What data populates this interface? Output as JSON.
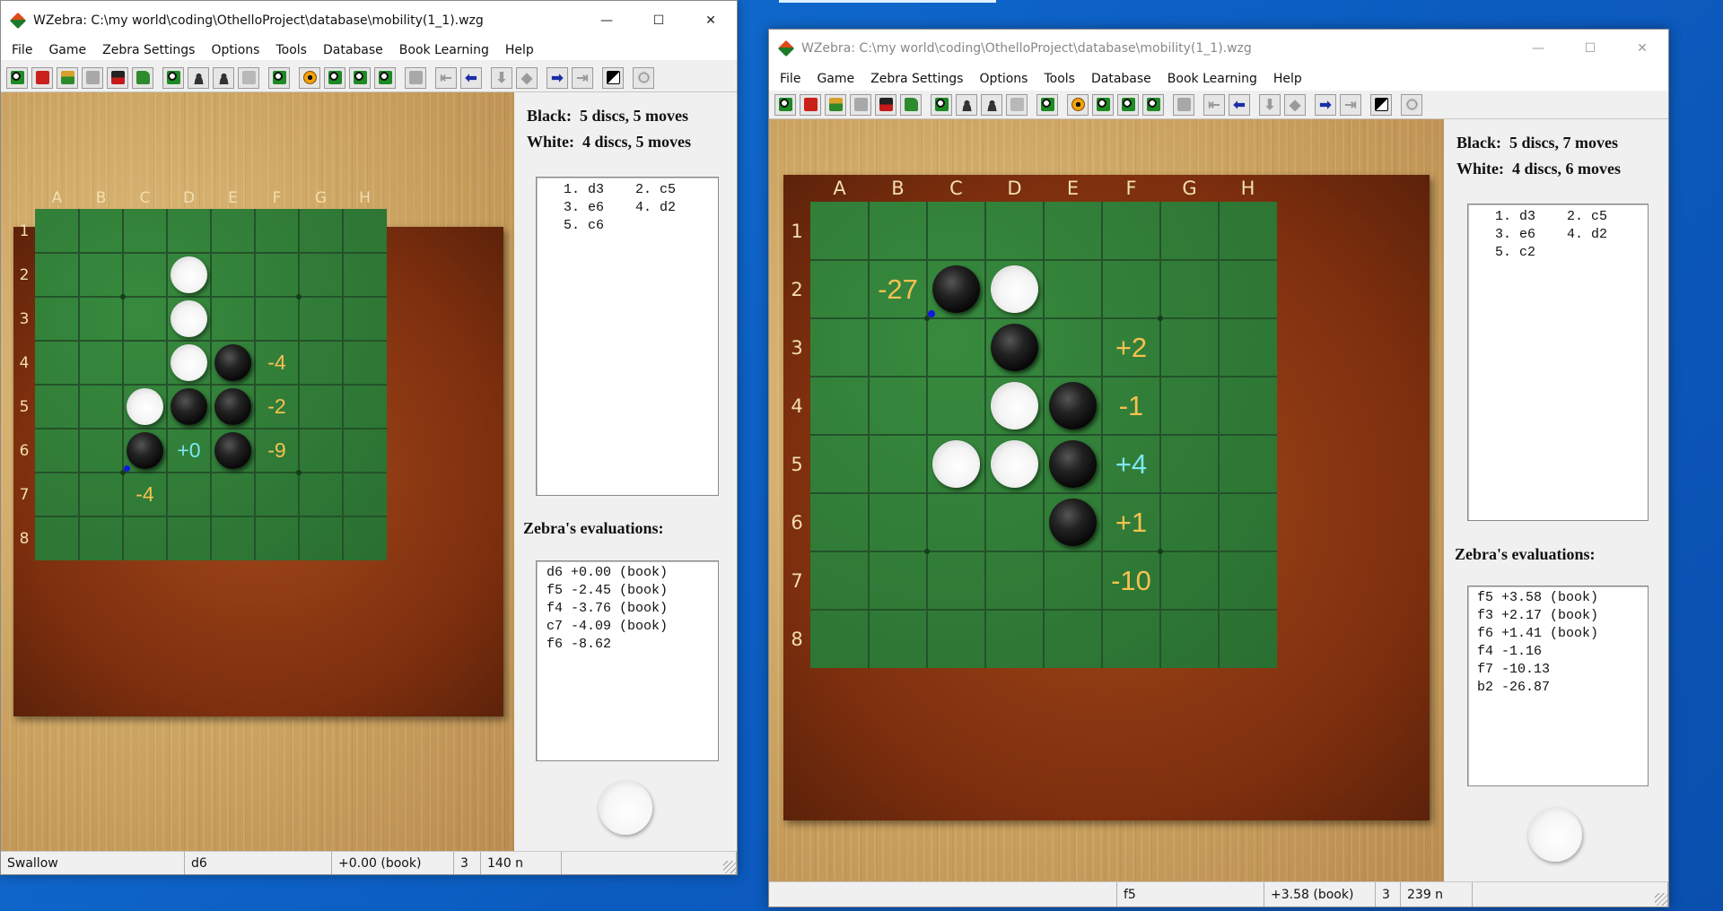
{
  "title_suffix": "",
  "windows": [
    {
      "id": "left",
      "title": "WZebra: C:\\my world\\coding\\OthelloProject\\database\\mobility(1_1).wzg",
      "active": true,
      "menu": [
        "File",
        "Game",
        "Zebra Settings",
        "Options",
        "Tools",
        "Database",
        "Book Learning",
        "Help"
      ],
      "columns": [
        "A",
        "B",
        "C",
        "D",
        "E",
        "F",
        "G",
        "H"
      ],
      "rows": [
        "1",
        "2",
        "3",
        "4",
        "5",
        "6",
        "7",
        "8"
      ],
      "discs": [
        {
          "sq": "d2",
          "color": "white"
        },
        {
          "sq": "d3",
          "color": "white"
        },
        {
          "sq": "d4",
          "color": "white"
        },
        {
          "sq": "e4",
          "color": "black"
        },
        {
          "sq": "c5",
          "color": "white"
        },
        {
          "sq": "d5",
          "color": "black"
        },
        {
          "sq": "e5",
          "color": "black"
        },
        {
          "sq": "c6",
          "color": "black"
        },
        {
          "sq": "e6",
          "color": "black"
        }
      ],
      "evals": [
        {
          "sq": "f4",
          "text": "-4",
          "best": false
        },
        {
          "sq": "f5",
          "text": "-2",
          "best": false
        },
        {
          "sq": "d6",
          "text": "+0",
          "best": true
        },
        {
          "sq": "f6",
          "text": "-9",
          "best": false
        },
        {
          "sq": "c7",
          "text": "-4",
          "best": false
        }
      ],
      "last_move": "c6",
      "black_count": "Black:  5 discs, 5 moves",
      "white_count": "White:  4 discs, 5 moves",
      "moves": [
        [
          "1. d3",
          "2. c5"
        ],
        [
          "3. e6",
          "4. d2"
        ],
        [
          "5. c6",
          ""
        ]
      ],
      "eval_title": "Zebra's evaluations:",
      "evaluations": [
        "d6 +0.00 (book)",
        "f5 -2.45 (book)",
        "f4 -3.76 (book)",
        "c7 -4.09 (book)",
        "f6 -8.62"
      ],
      "to_move": "white",
      "status": [
        "Swallow",
        "d6",
        "+0.00 (book)",
        "3",
        "140 n",
        ""
      ]
    },
    {
      "id": "right",
      "title": "WZebra: C:\\my world\\coding\\OthelloProject\\database\\mobility(1_1).wzg",
      "active": false,
      "menu": [
        "File",
        "Game",
        "Zebra Settings",
        "Options",
        "Tools",
        "Database",
        "Book Learning",
        "Help"
      ],
      "columns": [
        "A",
        "B",
        "C",
        "D",
        "E",
        "F",
        "G",
        "H"
      ],
      "rows": [
        "1",
        "2",
        "3",
        "4",
        "5",
        "6",
        "7",
        "8"
      ],
      "discs": [
        {
          "sq": "c2",
          "color": "black"
        },
        {
          "sq": "d2",
          "color": "white"
        },
        {
          "sq": "d3",
          "color": "black"
        },
        {
          "sq": "d4",
          "color": "white"
        },
        {
          "sq": "e4",
          "color": "black"
        },
        {
          "sq": "c5",
          "color": "white"
        },
        {
          "sq": "d5",
          "color": "white"
        },
        {
          "sq": "e5",
          "color": "black"
        },
        {
          "sq": "e6",
          "color": "black"
        }
      ],
      "evals": [
        {
          "sq": "b2",
          "text": "-27",
          "best": false
        },
        {
          "sq": "f3",
          "text": "+2",
          "best": false
        },
        {
          "sq": "f4",
          "text": "-1",
          "best": false
        },
        {
          "sq": "f5",
          "text": "+4",
          "best": true
        },
        {
          "sq": "f6",
          "text": "+1",
          "best": false
        },
        {
          "sq": "f7",
          "text": "-10",
          "best": false
        }
      ],
      "last_move": "c2",
      "black_count": "Black:  5 discs, 7 moves",
      "white_count": "White:  4 discs, 6 moves",
      "moves": [
        [
          "1. d3",
          "2. c5"
        ],
        [
          "3. e6",
          "4. d2"
        ],
        [
          "5. c2",
          ""
        ]
      ],
      "eval_title": "Zebra's evaluations:",
      "evaluations": [
        "f5 +3.58 (book)",
        "f3 +2.17 (book)",
        "f6 +1.41 (book)",
        "f4 -1.16",
        "f7 -10.13",
        "b2 -26.87"
      ],
      "to_move": "white",
      "status": [
        "",
        "f5",
        "+3.58 (book)",
        "3",
        "239 n",
        ""
      ]
    }
  ],
  "toolbar_icons": [
    "new-game",
    "red-book",
    "book",
    "gray",
    "dark-book",
    "open-folder",
    "play-green",
    "people",
    "people",
    "zz",
    "play-green",
    "stop-orange",
    "green",
    "green",
    "green",
    "gray",
    "first",
    "back",
    "down",
    "pin",
    "forward",
    "last",
    "mono",
    "globe"
  ]
}
